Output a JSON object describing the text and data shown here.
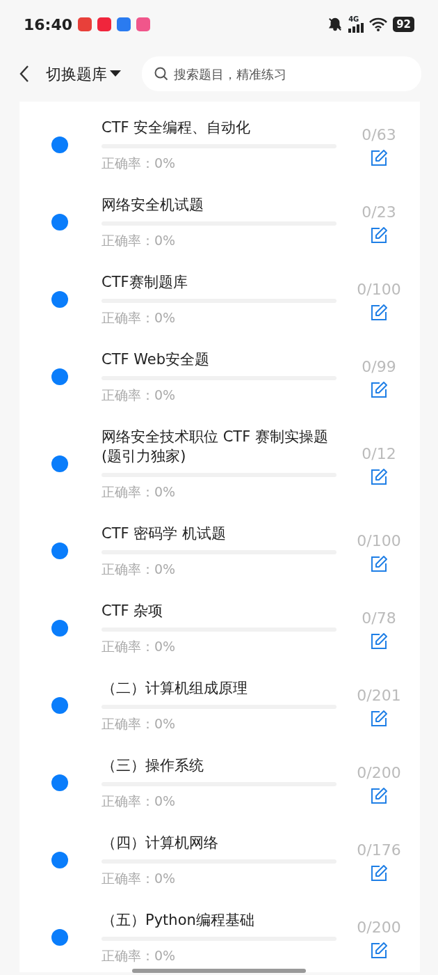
{
  "status_bar": {
    "time": "16:40",
    "network": "4G",
    "battery": "92"
  },
  "header": {
    "title": "切换题库",
    "search": {
      "placeholder": "搜索题目，精准练习"
    }
  },
  "banks": [
    {
      "title": "CTF 安全编程、自动化",
      "level": 0,
      "accuracy": "正确率：0%",
      "count": "0/63"
    },
    {
      "title": "网络安全机试题",
      "level": 0,
      "accuracy": "正确率：0%",
      "count": "0/23"
    },
    {
      "title": "CTF赛制题库",
      "level": 0,
      "accuracy": "正确率：0%",
      "count": "0/100"
    },
    {
      "title": "CTF Web安全题",
      "level": 0,
      "accuracy": "正确率：0%",
      "count": "0/99"
    },
    {
      "title": "网络安全技术职位 CTF 赛制实操题(题引力独家)",
      "level": 0,
      "accuracy": "正确率：0%",
      "count": "0/12"
    },
    {
      "title": "CTF 密码学 机试题",
      "level": 0,
      "accuracy": "正确率：0%",
      "count": "0/100"
    },
    {
      "title": "CTF 杂项",
      "level": 0,
      "accuracy": "正确率：0%",
      "count": "0/78"
    },
    {
      "title": "（二）计算机组成原理",
      "level": 0,
      "accuracy": "正确率：0%",
      "count": "0/201"
    },
    {
      "title": "（三）操作系统",
      "level": 0,
      "accuracy": "正确率：0%",
      "count": "0/200"
    },
    {
      "title": "（四）计算机网络",
      "level": 0,
      "accuracy": "正确率：0%",
      "count": "0/176"
    },
    {
      "title": "（五）Python编程基础",
      "level": 0,
      "accuracy": "正确率：0%",
      "count": "0/200"
    }
  ]
}
